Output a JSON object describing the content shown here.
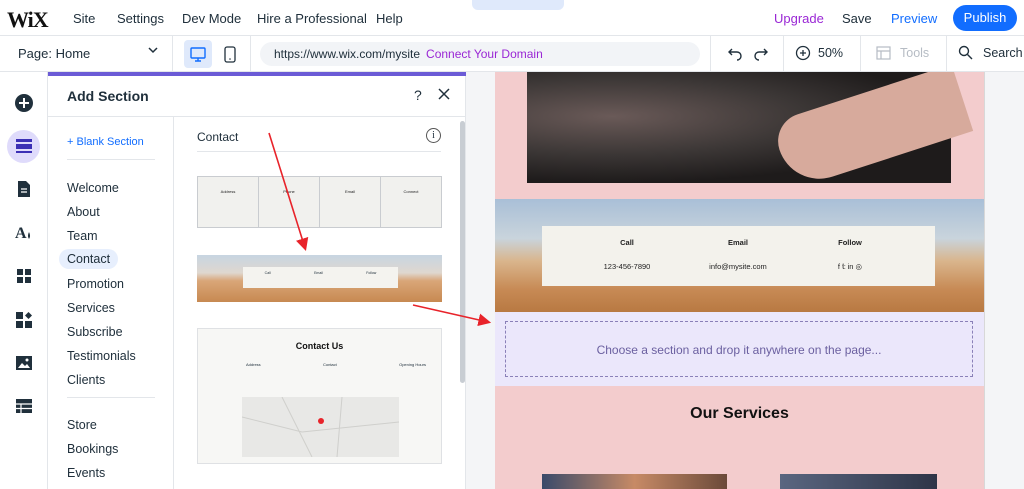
{
  "app": {
    "logo": "WiX",
    "nav": [
      "Site",
      "Settings",
      "Dev Mode",
      "Hire a Professional",
      "Help"
    ],
    "upgrade": "Upgrade",
    "save": "Save",
    "preview": "Preview",
    "publish": "Publish",
    "collapse_glyph": "⌃"
  },
  "toolbar": {
    "page_label": "Page: Home",
    "url": "https://www.wix.com/mysite",
    "connect_domain": "Connect Your Domain",
    "zoom": "50%",
    "tools": "Tools",
    "search": "Search"
  },
  "panel": {
    "title": "Add Section",
    "help": "?",
    "blank_section": "+ Blank Section",
    "categories_group1": [
      "Welcome",
      "About",
      "Team",
      "Contact",
      "Promotion",
      "Services",
      "Subscribe",
      "Testimonials",
      "Clients"
    ],
    "categories_group2": [
      "Store",
      "Bookings",
      "Events"
    ],
    "active_category": "Contact",
    "section_heading": "Contact",
    "info_glyph": "i",
    "thumb1_cells": [
      "Address",
      "Phone",
      "Email",
      "Connect"
    ],
    "thumb2_cells": [
      "Call",
      "Email",
      "Follow"
    ],
    "thumb3_title": "Contact Us",
    "thumb3_cols": [
      "Address",
      "Contact",
      "Opening Hours"
    ]
  },
  "canvas": {
    "contact_card": {
      "call_label": "Call",
      "call_value": "123-456-7890",
      "email_label": "Email",
      "email_value": "info@mysite.com",
      "follow_label": "Follow",
      "follow_icons": "f  𝕥  in  ◎"
    },
    "drop_text": "Choose a section and drop it anywhere on the page...",
    "services_heading": "Our Services"
  },
  "colors": {
    "accent_blue": "#116dff",
    "upgrade_purple": "#9a27d5",
    "panel_topline": "#6b5bd6",
    "site_pink": "#f3cccd",
    "dropzone": "#ebe7fb",
    "arrow_red": "#e8232a"
  }
}
